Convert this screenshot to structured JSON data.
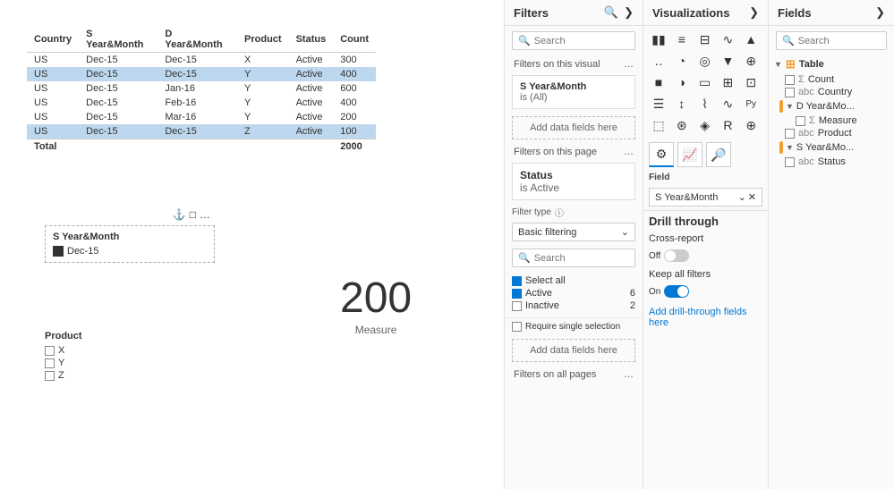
{
  "filters": {
    "panel_title": "Filters",
    "search_placeholder": "Search",
    "filters_on_visual": "Filters on this visual",
    "visual_filter_name": "S Year&Month",
    "visual_filter_value": "is (All)",
    "add_data_fields": "Add data fields here",
    "filters_on_page": "Filters on this page",
    "status_filter_title": "Status",
    "status_filter_value": "is Active",
    "filter_type_label": "Filter type",
    "filter_type_info": "ⓘ",
    "filter_type_value": "Basic filtering",
    "search_placeholder2": "Search",
    "select_all": "Select all",
    "option_active": "Active",
    "option_active_count": "6",
    "option_inactive": "Inactive",
    "option_inactive_count": "2",
    "require_single": "Require single selection",
    "add_data_fields2": "Add data fields here",
    "filters_on_all_pages": "Filters on all pages"
  },
  "visualizations": {
    "panel_title": "Visualizations",
    "field_label": "Field",
    "field_value": "S Year&Month",
    "drill_title": "Drill through",
    "cross_report": "Cross-report",
    "cross_report_state": "Off",
    "keep_all_filters": "Keep all filters",
    "keep_all_state": "On",
    "add_drill": "Add drill-through fields here"
  },
  "fields": {
    "panel_title": "Fields",
    "search_placeholder": "Search",
    "table_group": "Table",
    "items": [
      {
        "name": "Count",
        "type": "sigma"
      },
      {
        "name": "Country",
        "type": "abc"
      },
      {
        "name": "D Year&Mo...",
        "type": "date",
        "expanded": true
      },
      {
        "name": "Measure",
        "type": "sigma"
      },
      {
        "name": "Product",
        "type": "abc"
      },
      {
        "name": "S Year&Mo...",
        "type": "date",
        "expanded": true
      },
      {
        "name": "Status",
        "type": "abc"
      }
    ]
  },
  "table": {
    "headers": [
      "Country",
      "S Year&Month",
      "D Year&Month",
      "Product",
      "Status",
      "Count"
    ],
    "rows": [
      {
        "country": "US",
        "s_year": "Dec-15",
        "d_year": "Dec-15",
        "product": "X",
        "status": "Active",
        "count": "300",
        "highlight": false
      },
      {
        "country": "US",
        "s_year": "Dec-15",
        "d_year": "Dec-15",
        "product": "Y",
        "status": "Active",
        "count": "400",
        "highlight": true
      },
      {
        "country": "US",
        "s_year": "Dec-15",
        "d_year": "Jan-16",
        "product": "Y",
        "status": "Active",
        "count": "600",
        "highlight": false
      },
      {
        "country": "US",
        "s_year": "Dec-15",
        "d_year": "Feb-16",
        "product": "Y",
        "status": "Active",
        "count": "400",
        "highlight": false
      },
      {
        "country": "US",
        "s_year": "Dec-15",
        "d_year": "Mar-16",
        "product": "Y",
        "status": "Active",
        "count": "200",
        "highlight": false
      },
      {
        "country": "US",
        "s_year": "Dec-15",
        "d_year": "Dec-15",
        "product": "Z",
        "status": "Active",
        "count": "100",
        "highlight": true
      }
    ],
    "total_label": "Total",
    "total_value": "2000"
  },
  "slicer": {
    "title": "S Year&Month",
    "value": "Dec-15"
  },
  "product_filter": {
    "title": "Product",
    "items": [
      "X",
      "Y",
      "Z"
    ]
  },
  "measure": {
    "value": "200",
    "label": "Measure"
  }
}
